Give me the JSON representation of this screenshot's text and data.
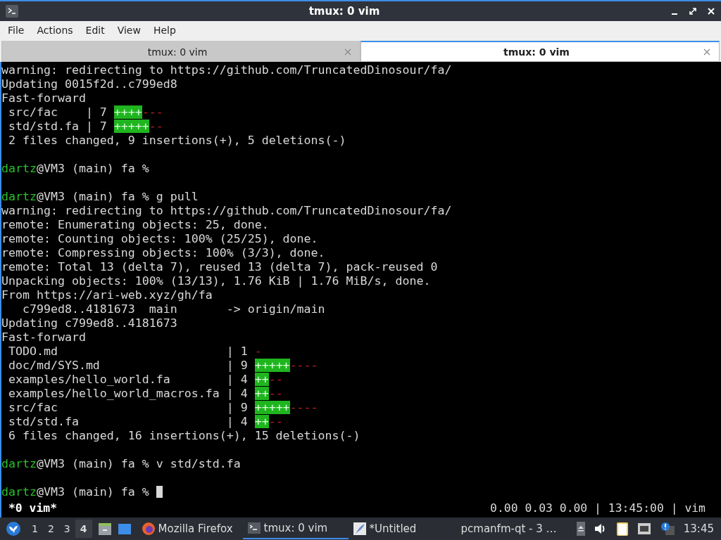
{
  "window": {
    "title": "tmux: 0 vim"
  },
  "menu": [
    "File",
    "Actions",
    "Edit",
    "View",
    "Help"
  ],
  "tabs": [
    {
      "label": "tmux: 0 vim",
      "selected": false
    },
    {
      "label": "tmux: 0 vim",
      "selected": true
    }
  ],
  "terminal": {
    "lines": [
      {
        "kind": "text",
        "text": "warning: redirecting to https://github.com/TruncatedDinosour/fa/"
      },
      {
        "kind": "text",
        "text": "Updating 0015f2d..c799ed8"
      },
      {
        "kind": "text",
        "text": "Fast-forward"
      },
      {
        "kind": "stat",
        "text": " src/fac    | 7 ",
        "plus": "++++",
        "minus": "---"
      },
      {
        "kind": "stat",
        "text": " std/std.fa | 7 ",
        "plus": "+++++",
        "minus": "--"
      },
      {
        "kind": "text",
        "text": " 2 files changed, 9 insertions(+), 5 deletions(-)"
      },
      {
        "kind": "blank"
      },
      {
        "kind": "prompt",
        "user": "dartz",
        "rest": "@VM3 (main) fa %",
        "cursor": false
      },
      {
        "kind": "blank"
      },
      {
        "kind": "prompt",
        "user": "dartz",
        "rest": "@VM3 (main) fa % g pull",
        "cursor": false
      },
      {
        "kind": "text",
        "text": "warning: redirecting to https://github.com/TruncatedDinosour/fa/"
      },
      {
        "kind": "text",
        "text": "remote: Enumerating objects: 25, done."
      },
      {
        "kind": "text",
        "text": "remote: Counting objects: 100% (25/25), done."
      },
      {
        "kind": "text",
        "text": "remote: Compressing objects: 100% (3/3), done."
      },
      {
        "kind": "text",
        "text": "remote: Total 13 (delta 7), reused 13 (delta 7), pack-reused 0"
      },
      {
        "kind": "text",
        "text": "Unpacking objects: 100% (13/13), 1.76 KiB | 1.76 MiB/s, done."
      },
      {
        "kind": "text",
        "text": "From https://ari-web.xyz/gh/fa"
      },
      {
        "kind": "text",
        "text": "   c799ed8..4181673  main       -> origin/main"
      },
      {
        "kind": "text",
        "text": "Updating c799ed8..4181673"
      },
      {
        "kind": "text",
        "text": "Fast-forward"
      },
      {
        "kind": "stat",
        "text": " TODO.md                        | 1 ",
        "minus": "-"
      },
      {
        "kind": "stat",
        "text": " doc/md/SYS.md                  | 9 ",
        "plus": "+++++",
        "minus": "----"
      },
      {
        "kind": "stat",
        "text": " examples/hello_world.fa        | 4 ",
        "plus": "++",
        "minus": "--"
      },
      {
        "kind": "stat",
        "text": " examples/hello_world_macros.fa | 4 ",
        "plus": "++",
        "minus": "--"
      },
      {
        "kind": "stat",
        "text": " src/fac                        | 9 ",
        "plus": "+++++",
        "minus": "----"
      },
      {
        "kind": "stat",
        "text": " std/std.fa                     | 4 ",
        "plus": "++",
        "minus": "--"
      },
      {
        "kind": "text",
        "text": " 6 files changed, 16 insertions(+), 15 deletions(-)"
      },
      {
        "kind": "blank"
      },
      {
        "kind": "prompt",
        "user": "dartz",
        "rest": "@VM3 (main) fa % v std/std.fa",
        "cursor": false
      },
      {
        "kind": "blank"
      },
      {
        "kind": "prompt",
        "user": "dartz",
        "rest": "@VM3 (main) fa % ",
        "cursor": true
      }
    ],
    "status": {
      "left": "*0 vim*",
      "right": "0.00 0.03 0.00 | 13:45:00 | vim"
    }
  },
  "taskbar": {
    "desktops": [
      {
        "label": "1",
        "selected": false
      },
      {
        "label": "2",
        "selected": false
      },
      {
        "label": "3",
        "selected": false
      },
      {
        "label": "4",
        "selected": true
      }
    ],
    "tasks": [
      {
        "kind": "firefox",
        "label": "Mozilla Firefox",
        "selected": false
      },
      {
        "kind": "terminal",
        "label": "tmux: 0 vim",
        "selected": true
      },
      {
        "kind": "editor",
        "label": "*Untitled",
        "selected": false
      },
      {
        "kind": "folder",
        "label": "pcmanfm-qt - 3 …",
        "selected": false
      }
    ],
    "clock": "13:45"
  }
}
